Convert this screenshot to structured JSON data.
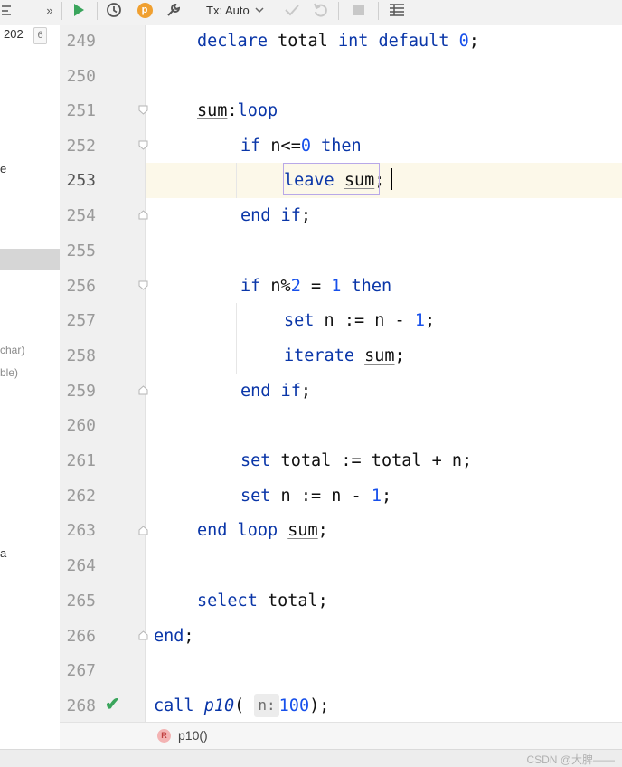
{
  "toolbar": {
    "overflow_label": "»",
    "tx_label": "Tx: Auto",
    "p_badge": "p"
  },
  "left_panel": {
    "row1_text": "202",
    "row1_badge": "6",
    "fragments": [
      "e",
      "char)",
      "ble)",
      "a"
    ]
  },
  "lines": [
    {
      "n": "249"
    },
    {
      "n": "250"
    },
    {
      "n": "251"
    },
    {
      "n": "252"
    },
    {
      "n": "253"
    },
    {
      "n": "254"
    },
    {
      "n": "255"
    },
    {
      "n": "256"
    },
    {
      "n": "257"
    },
    {
      "n": "258"
    },
    {
      "n": "259"
    },
    {
      "n": "260"
    },
    {
      "n": "261"
    },
    {
      "n": "262"
    },
    {
      "n": "263"
    },
    {
      "n": "264"
    },
    {
      "n": "265"
    },
    {
      "n": "266"
    },
    {
      "n": "267"
    },
    {
      "n": "268"
    }
  ],
  "code": {
    "l249": {
      "a": "declare",
      "b": " total ",
      "c": "int default",
      "d": " ",
      "e": "0",
      "f": ";"
    },
    "l251": {
      "a": "sum",
      "b": ":",
      "c": "loop"
    },
    "l252": {
      "a": "if",
      "b": " n<=",
      "c": "0",
      "d": " then"
    },
    "l253": {
      "a": "leave",
      "b": " ",
      "c": "sum",
      "d": ";"
    },
    "l254": {
      "a": "end if",
      "b": ";"
    },
    "l256": {
      "a": "if",
      "b": " n%",
      "c": "2",
      "d": " = ",
      "e": "1",
      "f": " then"
    },
    "l257": {
      "a": "set",
      "b": " n := n - ",
      "c": "1",
      "d": ";"
    },
    "l258": {
      "a": "iterate",
      "b": " ",
      "c": "sum",
      "d": ";"
    },
    "l259": {
      "a": "end if",
      "b": ";"
    },
    "l261": {
      "a": "set",
      "b": " total := total + n;"
    },
    "l262": {
      "a": "set",
      "b": " n := n - ",
      "c": "1",
      "d": ";"
    },
    "l263": {
      "a": "end loop",
      "b": " ",
      "c": "sum",
      "d": ";"
    },
    "l265": {
      "a": "select",
      "b": " total;"
    },
    "l266": {
      "a": "end",
      "b": ";"
    },
    "l268": {
      "a": "call",
      "b": " ",
      "c": "p10",
      "d": "(",
      "hint": "n:",
      "e": " ",
      "f": "100",
      "g": ");"
    }
  },
  "breadcrumb": {
    "icon_letter": "R",
    "label": "p10()"
  },
  "watermark": "CSDN @大脾——",
  "colors": {
    "keyword": "#0a36a8",
    "number": "#1750eb",
    "current_line": "#fcf8e9",
    "run_green": "#3aa55c"
  }
}
